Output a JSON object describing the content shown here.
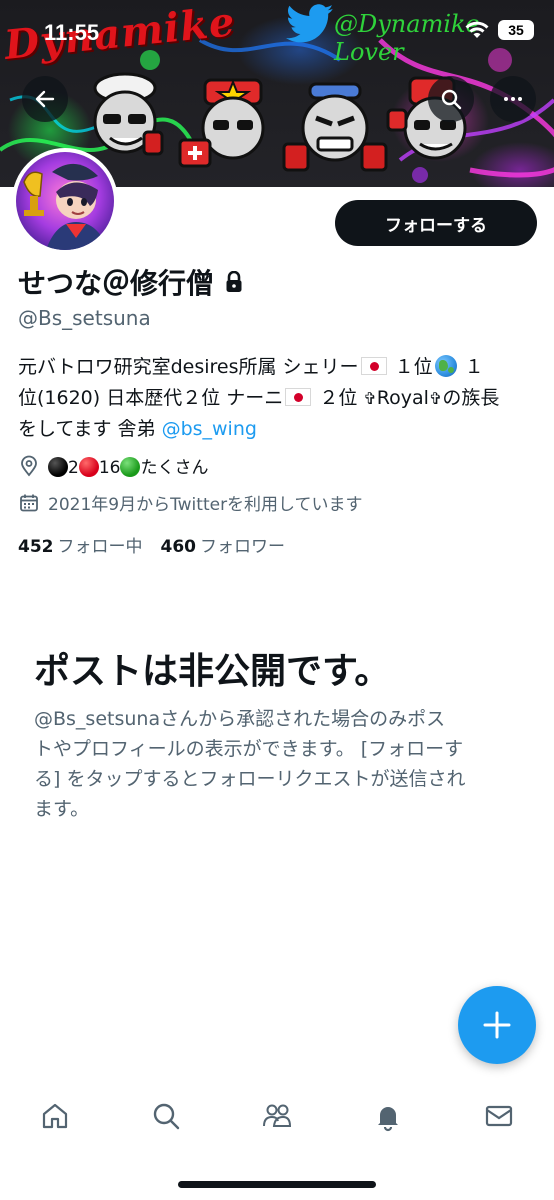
{
  "status_bar": {
    "time": "11:55",
    "battery": "35"
  },
  "banner": {
    "wordmark": "Dynamike",
    "overlay_handle": "@Dynamike Lover"
  },
  "profile": {
    "display_name": "せつな＠修行僧",
    "handle": "@Bs_setsuna",
    "follow_button": "フォローする",
    "bio": {
      "line1_a": "元バトロワ研究室desires所属 シェリー",
      "line1_b": "１位",
      "line1_c": "１",
      "line2_a": "位(1620) 日本歴代２位 ナーニ",
      "line2_b": "２位",
      "line2_cross1": "✞",
      "line2_c": "Royal",
      "line2_cross2": "✞",
      "line2_d": "の族長",
      "line3_a": "をしてます 舎弟 ",
      "line3_link": "@bs_wing"
    },
    "location": {
      "n1": "2",
      "n2": "16",
      "text": "たくさん"
    },
    "joined": "2021年9月からTwitterを利用しています",
    "following_count": "452",
    "following_label": "フォロー中",
    "followers_count": "460",
    "followers_label": "フォロワー"
  },
  "private_notice": {
    "title": "ポストは非公開です。",
    "body_line1": "@Bs_setsunaさんから承認された場合のみポス",
    "body_line2": "トやプロフィールの表示ができます。 [フォローす",
    "body_line3": "る] をタップするとフォローリクエストが送信され",
    "body_line4": "ます。"
  },
  "icons": {
    "back": "arrow-left-icon",
    "search": "search-icon",
    "more": "more-horizontal-icon",
    "lock": "lock-icon",
    "location": "location-pin-icon",
    "calendar": "calendar-icon",
    "fab": "plus-icon",
    "nav": [
      "home-icon",
      "search-icon",
      "communities-icon",
      "bell-icon",
      "envelope-icon"
    ]
  },
  "colors": {
    "accent": "#1d9bf0",
    "text_primary": "#0f1419",
    "text_secondary": "#536471",
    "follow_button_bg": "#0f1419"
  }
}
